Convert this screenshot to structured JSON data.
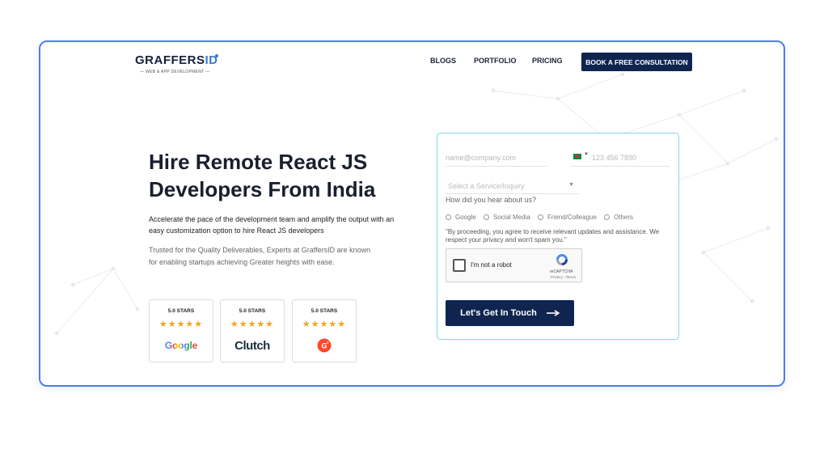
{
  "brand": {
    "logo_g": "G",
    "logo_mid": "RAFFERS",
    "logo_id": "ID",
    "tagline": "— WEB & APP DEVELOPMENT —"
  },
  "nav": {
    "items": [
      "BLOGS",
      "PORTFOLIO",
      "PRICING"
    ],
    "cta_label": "BOOK A FREE CONSULTATION"
  },
  "hero": {
    "title_line1": "Hire Remote React JS",
    "title_line2": "Developers From India",
    "description": "Accelerate the pace of the development team and amplify the output with an easy customization option to hire React JS developers",
    "trust_text": "Trusted for the Quality Deliverables, Experts at GraffersID are known for enabling startups achieving Greater heights with ease."
  },
  "badges": [
    {
      "label": "5.0 STARS",
      "stars": "★★★★★",
      "platform": "Google"
    },
    {
      "label": "5.0 STARS",
      "stars": "★★★★★",
      "platform": "Clutch"
    },
    {
      "label": "5.0 STARS",
      "stars": "★★★★★",
      "platform": "G2"
    }
  ],
  "form": {
    "email_placeholder": "name@company.com",
    "phone_placeholder": "123 456 7890",
    "service_placeholder": "Select a Service/Inquiry",
    "question": "How did you hear about us?",
    "sources": [
      "Google",
      "Social Media",
      "Friend/Colleague",
      "Others"
    ],
    "consent": "\"By proceeding, you agree to receive relevant updates and assistance. We respect your privacy and won't spam you.\"",
    "recaptcha_label": "I'm not a robot",
    "recaptcha_brand": "reCAPTCHA",
    "recaptcha_terms": "Privacy - Terms",
    "submit_label": "Let's Get In Touch"
  },
  "colors": {
    "frame_border": "#4f7cf0",
    "primary": "#0f2550",
    "form_border": "#7fd6e8",
    "star": "#f4a21c"
  }
}
